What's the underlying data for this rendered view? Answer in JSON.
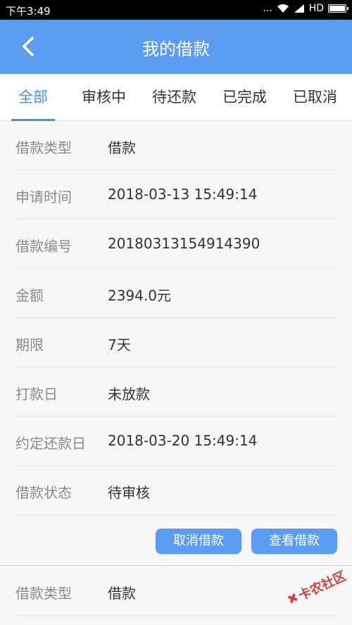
{
  "status_bar": {
    "time": "下午3:49",
    "dots": "...",
    "network": "HD",
    "battery_level": 0.9
  },
  "nav": {
    "title": "我的借款"
  },
  "tabs": [
    {
      "label": "全部",
      "active": true
    },
    {
      "label": "审核中",
      "active": false
    },
    {
      "label": "待还款",
      "active": false
    },
    {
      "label": "已完成",
      "active": false
    },
    {
      "label": "已取消",
      "active": false
    }
  ],
  "loan_card_1": {
    "rows": [
      {
        "label": "借款类型",
        "value": "借款"
      },
      {
        "label": "申请时间",
        "value": "2018-03-13 15:49:14"
      },
      {
        "label": "借款编号",
        "value": "20180313154914390"
      },
      {
        "label": "金额",
        "value": "2394.0元"
      },
      {
        "label": "期限",
        "value": "7天"
      },
      {
        "label": "打款日",
        "value": "未放款"
      },
      {
        "label": "约定还款日",
        "value": "2018-03-20 15:49:14"
      },
      {
        "label": "借款状态",
        "value": "待审核"
      }
    ],
    "cancel_label": "取消借款",
    "view_label": "查看借款"
  },
  "loan_card_2": {
    "rows": [
      {
        "label": "借款类型",
        "value": "借款"
      }
    ]
  },
  "watermark": "卡农社区",
  "colors": {
    "primary": "#5b9cf0",
    "tab_active": "#4a8fe7",
    "button": "#5a9cf2"
  }
}
